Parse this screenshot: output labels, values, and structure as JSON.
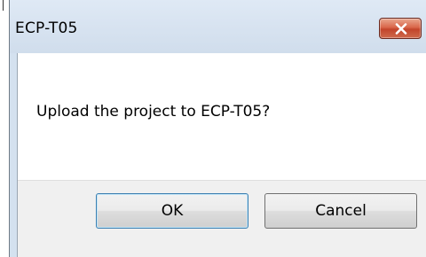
{
  "window": {
    "title": "ECP-T05",
    "close_icon": "close-icon"
  },
  "message": {
    "text": "Upload the project to ECP-T05?"
  },
  "buttons": {
    "ok_label": "OK",
    "cancel_label": "Cancel"
  },
  "colors": {
    "title_bar": "#d4e1ef",
    "close_button": "#c7492f",
    "button_area": "#f0f0f0",
    "default_button_border": "#3c7fb1"
  }
}
